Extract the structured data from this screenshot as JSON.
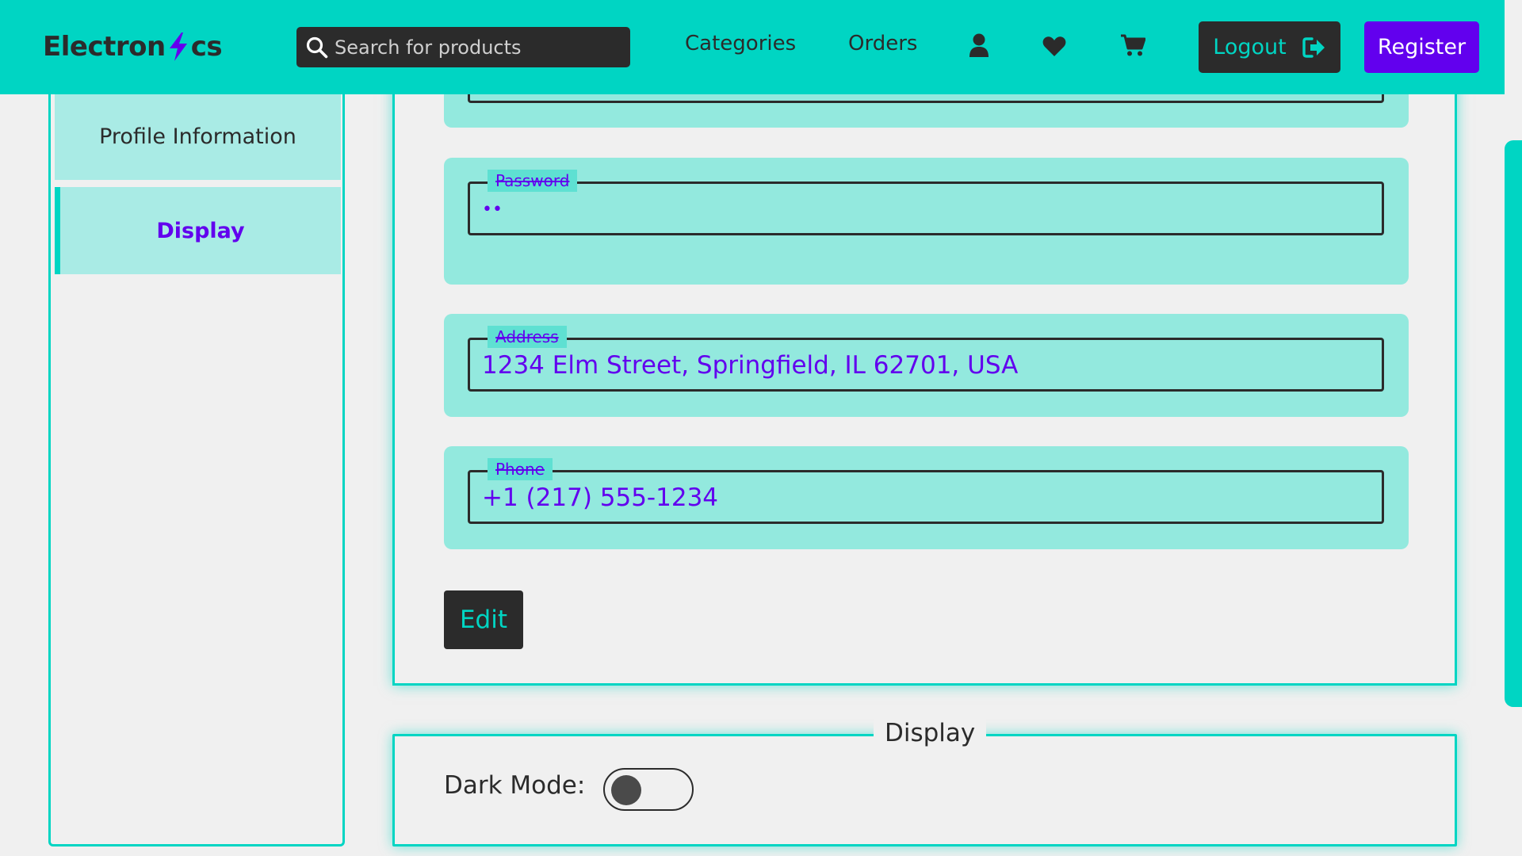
{
  "header": {
    "logo_left": "Electron",
    "logo_right": "cs",
    "search_placeholder": "Search for products",
    "nav": {
      "categories": "Categories",
      "orders": "Orders"
    },
    "icons": [
      "user-icon",
      "heart-icon",
      "cart-icon"
    ],
    "logout_label": "Logout",
    "register_label": "Register"
  },
  "sidebar": {
    "items": [
      {
        "label": "Profile Information",
        "active": false
      },
      {
        "label": "Display",
        "active": true
      }
    ]
  },
  "profile": {
    "fields": [
      {
        "label": "Password",
        "value": "••"
      },
      {
        "label": "Address",
        "value": "1234 Elm Street, Springfield, IL 62701, USA"
      },
      {
        "label": "Phone",
        "value": "+1 (217) 555-1234"
      }
    ],
    "edit_label": "Edit"
  },
  "display": {
    "title": "Display",
    "dark_mode_label": "Dark Mode:",
    "dark_mode_on": false
  },
  "colors": {
    "accent": "#00d5c3",
    "primary": "#6200ee",
    "dark": "#2b2b2b",
    "panel": "#93e9de",
    "background": "#f0f0f0"
  }
}
